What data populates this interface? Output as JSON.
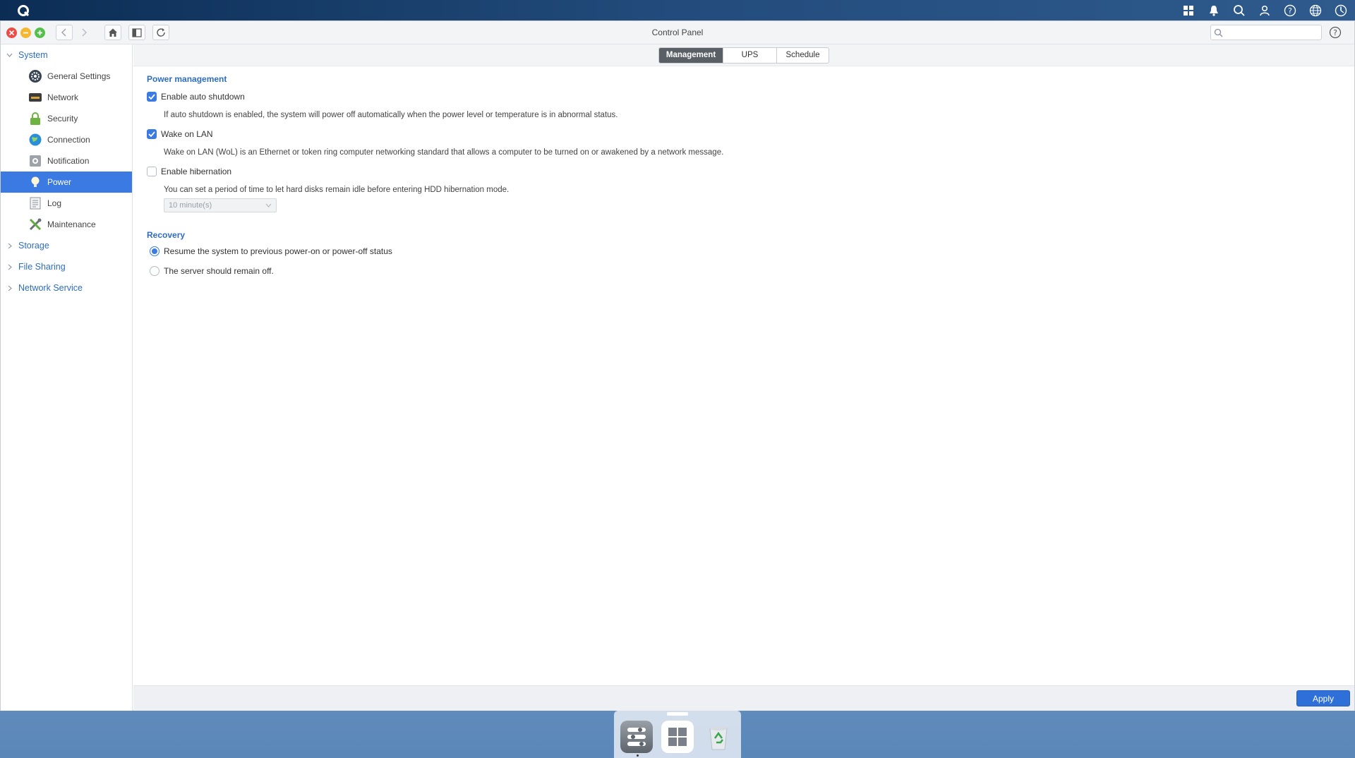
{
  "window": {
    "title": "Control Panel"
  },
  "search": {
    "placeholder": ""
  },
  "sidebar": {
    "groups": [
      {
        "label": "System",
        "expanded": true
      },
      {
        "label": "Storage",
        "expanded": false
      },
      {
        "label": "File Sharing",
        "expanded": false
      },
      {
        "label": "Network Service",
        "expanded": false
      }
    ],
    "items": [
      {
        "label": "General Settings",
        "icon": "gear-icon"
      },
      {
        "label": "Network",
        "icon": "network-icon"
      },
      {
        "label": "Security",
        "icon": "lock-icon"
      },
      {
        "label": "Connection",
        "icon": "globe-icon"
      },
      {
        "label": "Notification",
        "icon": "bell-icon"
      },
      {
        "label": "Power",
        "icon": "bulb-icon",
        "active": true
      },
      {
        "label": "Log",
        "icon": "log-icon"
      },
      {
        "label": "Maintenance",
        "icon": "tools-icon"
      }
    ]
  },
  "tabs": [
    {
      "label": "Management",
      "active": true
    },
    {
      "label": "UPS"
    },
    {
      "label": "Schedule"
    }
  ],
  "power_management": {
    "title": "Power management",
    "auto_shutdown": {
      "label": "Enable auto shutdown",
      "checked": true,
      "description": "If auto shutdown is enabled, the system will power off automatically when the power level or temperature is in abnormal status."
    },
    "wake_on_lan": {
      "label": "Wake on LAN",
      "checked": true,
      "description": "Wake on LAN (WoL) is an Ethernet or token ring computer networking standard that allows a computer to be turned on or awakened by a network message."
    },
    "hibernation": {
      "label": "Enable hibernation",
      "checked": false,
      "description": "You can set a period of time to let hard disks remain idle before entering HDD hibernation mode.",
      "period_value": "10 minute(s)"
    }
  },
  "recovery": {
    "title": "Recovery",
    "options": [
      {
        "label": "Resume the system to previous power-on or power-off status",
        "selected": true
      },
      {
        "label": "The server should remain off.",
        "selected": false
      }
    ]
  },
  "footer": {
    "apply_label": "Apply"
  },
  "colors": {
    "accent": "#3b7ae3",
    "section_title": "#2d6cc4",
    "topbar": "#0b2d55"
  }
}
